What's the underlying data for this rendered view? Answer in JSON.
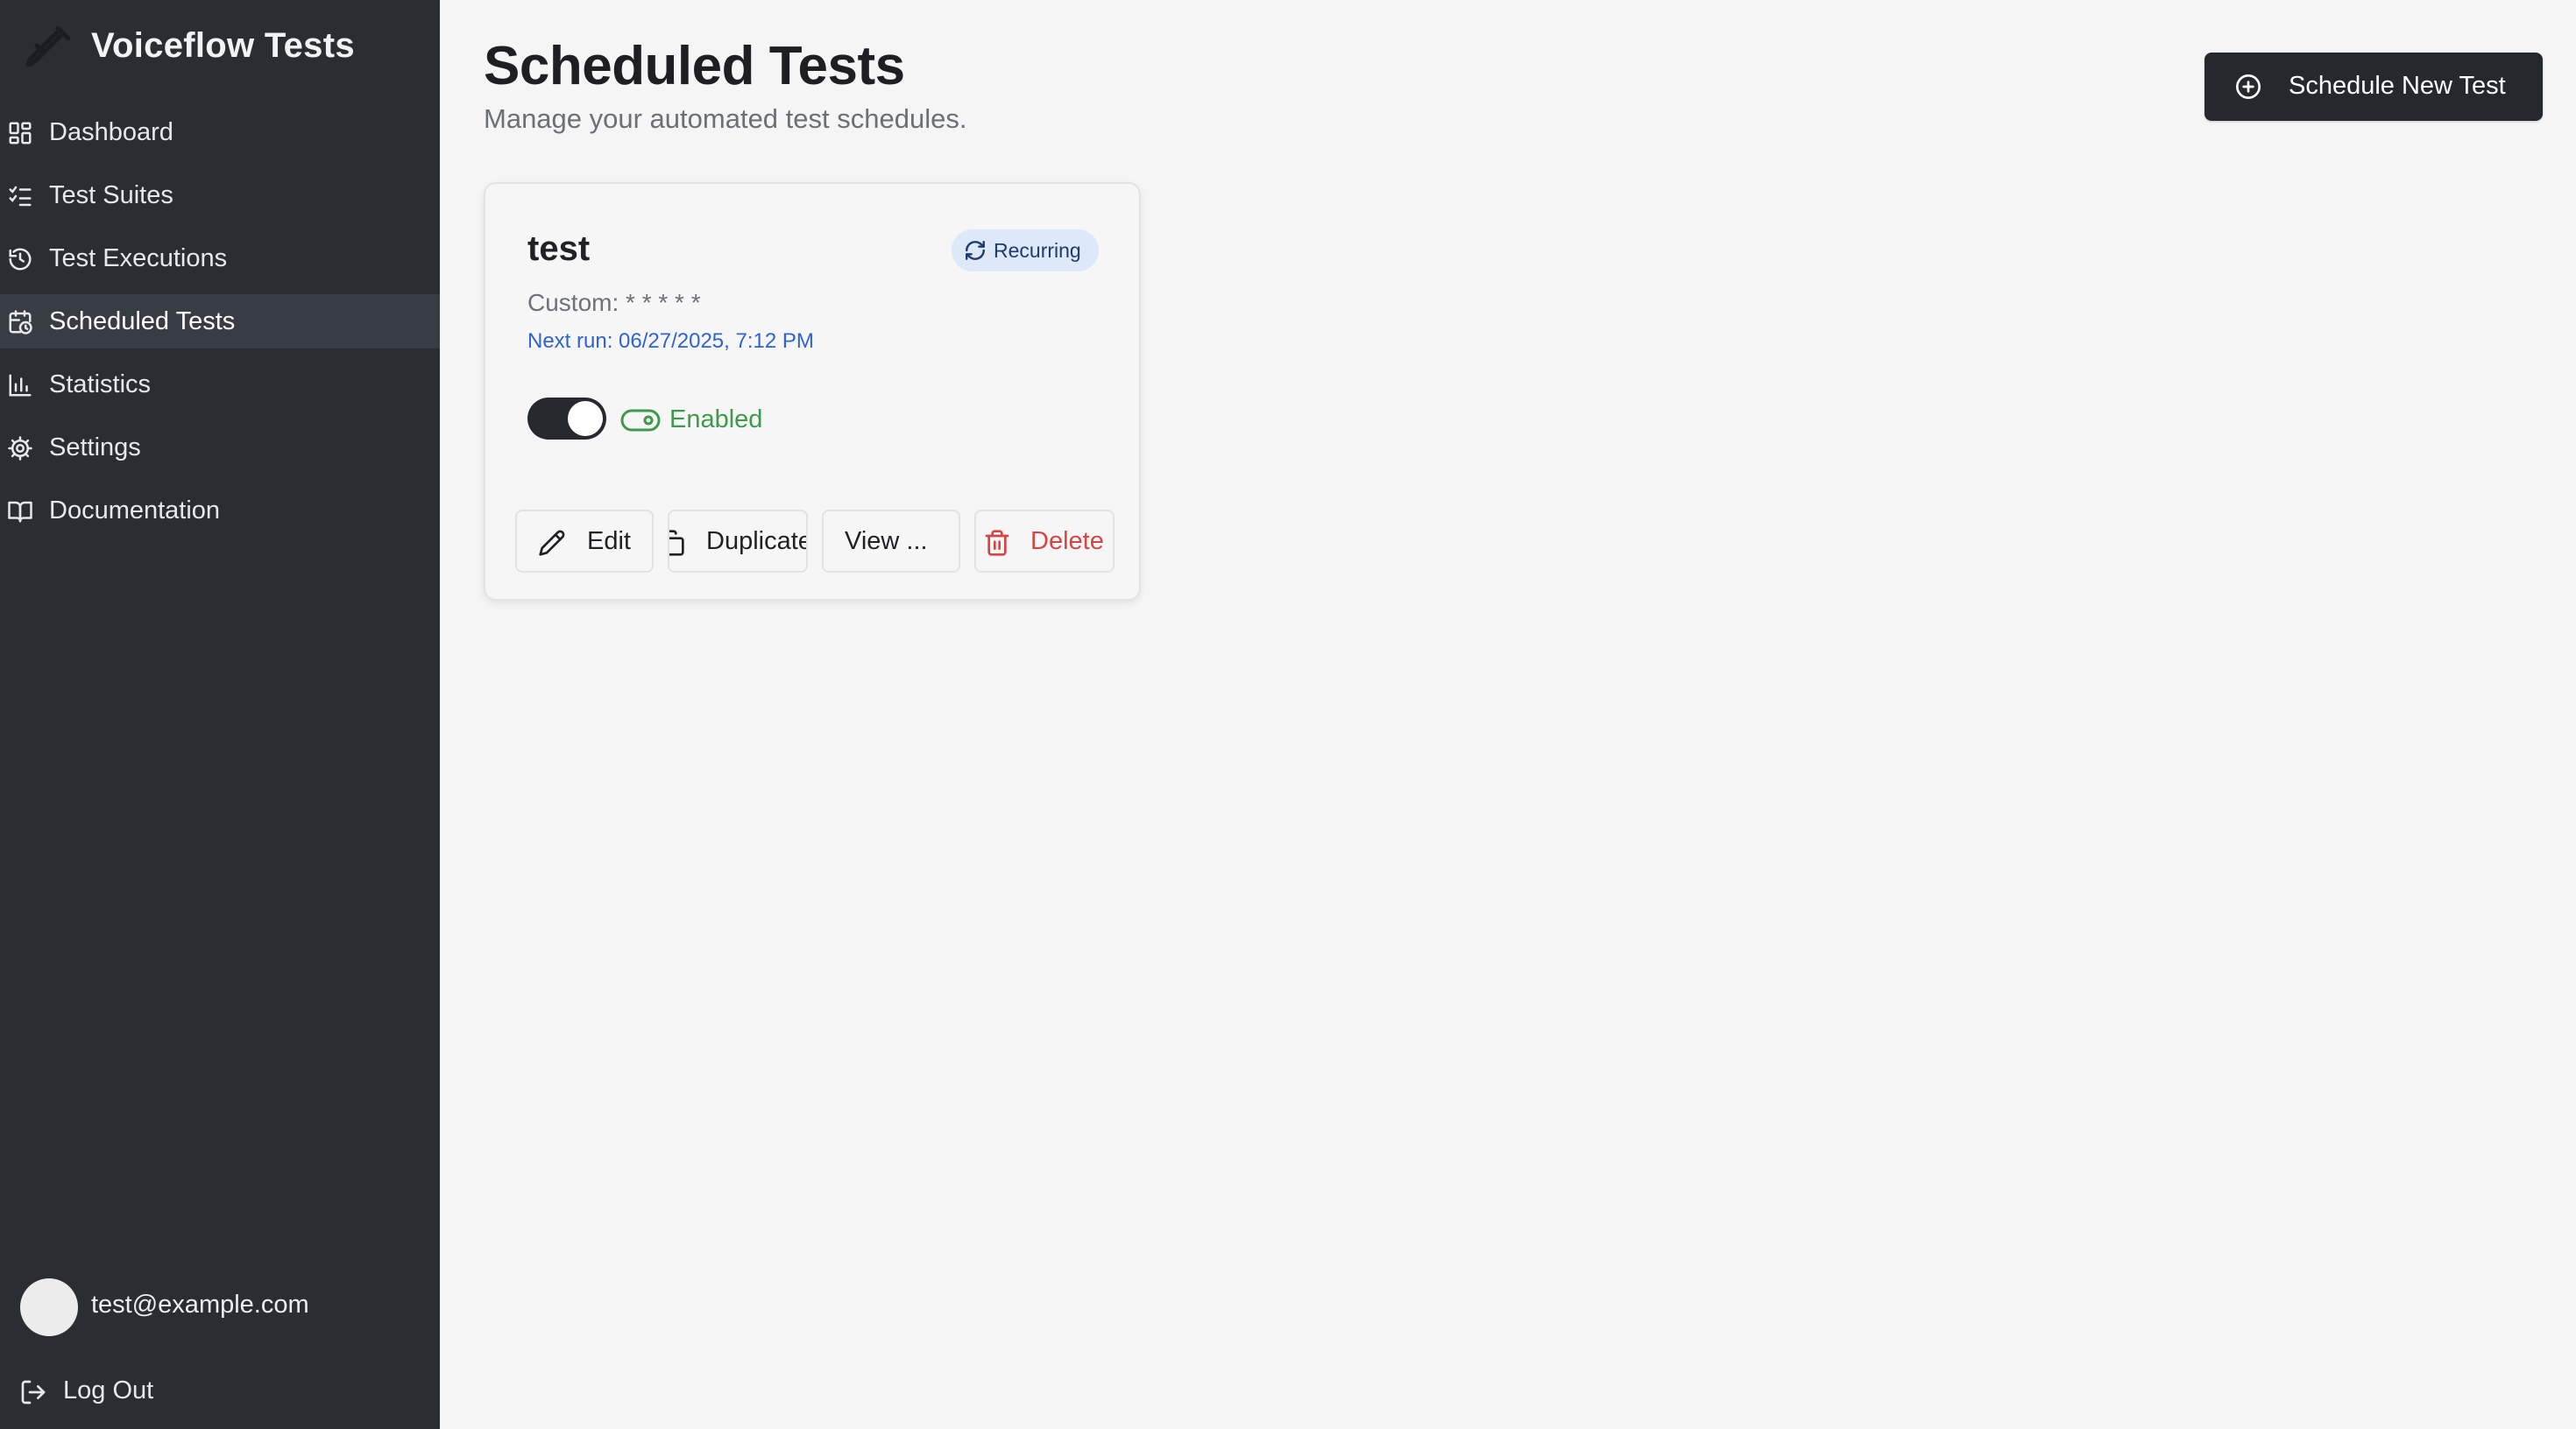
{
  "sidebar": {
    "brand": {
      "title": "Voiceflow Tests",
      "icon": "test-tube-icon"
    },
    "nav": [
      {
        "label": "Dashboard",
        "icon": "layout-grid-icon",
        "active": false
      },
      {
        "label": "Test Suites",
        "icon": "list-checks-icon",
        "active": false
      },
      {
        "label": "Test Executions",
        "icon": "history-icon",
        "active": false
      },
      {
        "label": "Scheduled Tests",
        "icon": "calendar-clock-icon",
        "active": true
      },
      {
        "label": "Statistics",
        "icon": "bar-chart-icon",
        "active": false
      },
      {
        "label": "Settings",
        "icon": "gear-icon",
        "active": false
      },
      {
        "label": "Documentation",
        "icon": "book-open-icon",
        "active": false
      }
    ],
    "user": {
      "email": "test@example.com"
    },
    "logout_label": "Log Out"
  },
  "header": {
    "title": "Scheduled Tests",
    "subtitle": "Manage your automated test schedules.",
    "primary_button": {
      "label": "Schedule New Test",
      "icon": "plus-circle-icon"
    }
  },
  "schedules": [
    {
      "name": "test",
      "badge": "Recurring",
      "schedule": "Custom: * * * * *",
      "next_run": "Next run: 06/27/2025, 7:12 PM",
      "enabled": true,
      "status_label": "Enabled",
      "actions": {
        "edit": "Edit",
        "duplicate": "Duplicate",
        "view": "View ...",
        "delete": "Delete"
      }
    }
  ],
  "colors": {
    "sidebar_bg": "#2a2d32",
    "sidebar_active": "#383c43",
    "page_bg": "#f5f5f5",
    "primary": "#25282d",
    "badge_bg": "#dde8f8",
    "link_blue": "#2f63d1",
    "success": "#3d9a4a",
    "danger": "#d64545"
  }
}
